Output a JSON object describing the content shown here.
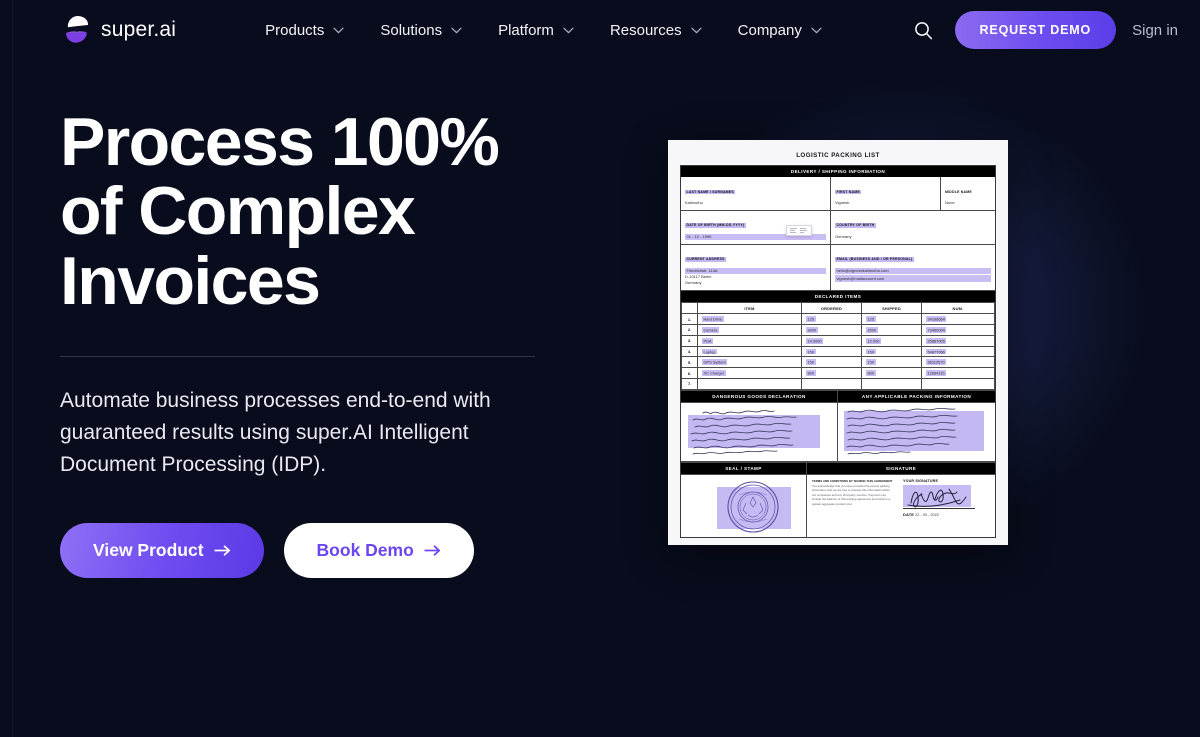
{
  "brand": {
    "name": "super.ai",
    "logo_icon": "superai-logo-mark",
    "accent": "#6d4df0",
    "accent_light": "#8f70f5",
    "background": "#080c1c"
  },
  "nav": {
    "items": [
      {
        "label": "Products",
        "icon": "chevron-down-icon"
      },
      {
        "label": "Solutions",
        "icon": "chevron-down-icon"
      },
      {
        "label": "Platform",
        "icon": "chevron-down-icon"
      },
      {
        "label": "Resources",
        "icon": "chevron-down-icon"
      },
      {
        "label": "Company",
        "icon": "chevron-down-icon"
      }
    ],
    "search_icon": "search-icon",
    "cta_label": "REQUEST DEMO",
    "signin_label": "Sign in"
  },
  "hero": {
    "headline_lines": [
      "Process 100%",
      "of Complex",
      "Invoices"
    ],
    "subtitle": "Automate business processes end-to-end with guaranteed results using super.AI Intelligent Document Processing (IDP).",
    "primary_cta": "View Product",
    "secondary_cta": "Book Demo",
    "cta_arrow": "arrow-right-icon"
  },
  "document": {
    "title": "LOGISTIC PACKING LIST",
    "section_delivery": "DELIVERY / SHIPPING INFORMATION",
    "fields": {
      "last_name_label": "LAST NAME / SURNAMES",
      "last_name_value": "Kalimuthu",
      "first_name_label": "FIRST NAME",
      "first_name_value": "Vignesh",
      "middle_name_label": "MIDDLE NAME",
      "middle_name_value": "None",
      "dob_label": "DATE OF BIRTH (MM-DD-YYYY)",
      "dob_value": "01 - 10 - 1990",
      "country_label": "COUNTRY OF BIRTH",
      "country_value": "Germany",
      "address_label": "CURRENT ADDRESS",
      "address_line1": "Friedrichstr. 114A",
      "address_line2": "D-10117 Berlin",
      "address_line3": "Germany",
      "email_label": "EMAIL (BUSINESS AND / OR PERSONAL)",
      "email_value1": "hello@vigneshkalimuthu.com",
      "email_value2": "vignesh@mailaccount.com"
    },
    "section_items": "DECLARED ITEMS",
    "items_headers": [
      "",
      "ITEM",
      "ORDERED",
      "SHIPPED",
      "NUM."
    ],
    "items_rows": [
      [
        "1.",
        "Hard Drive",
        "125",
        "125",
        "34166664"
      ],
      [
        "2.",
        "Camera",
        "3000",
        "2500",
        "73460004"
      ],
      [
        "3.",
        "PDA",
        "14.0000",
        "12.000",
        "25887005"
      ],
      [
        "4.",
        "Laptop",
        "150",
        "150",
        "54877066"
      ],
      [
        "5.",
        "GPS System",
        "150",
        "150",
        "36112570"
      ],
      [
        "6.",
        "XC Charger",
        "800",
        "800",
        "12664115"
      ],
      [
        "7.",
        "",
        "",
        "",
        ""
      ]
    ],
    "section_dangerous": "DANGEROUS GOODS DECLARATION",
    "section_packing": "ANY APPLICABLE PACKING INFORMATION",
    "section_seal": "SEAL / STAMP",
    "section_signature": "SIGNATURE",
    "terms_bold": "TERMS AND CONDITIONS BY SIGNING THIS AGREEMENT",
    "terms_text": " You acknowledge that you have provided the correct packing information and we are free to process this information within our companies and any third party vendors. Payment may include the balance of that existing agreement and result in a greater aggregate product cost.",
    "signature_label": "YOUR SIGNATURE",
    "date_label": "DATE",
    "date_value": "22 - 03 - 2022"
  }
}
